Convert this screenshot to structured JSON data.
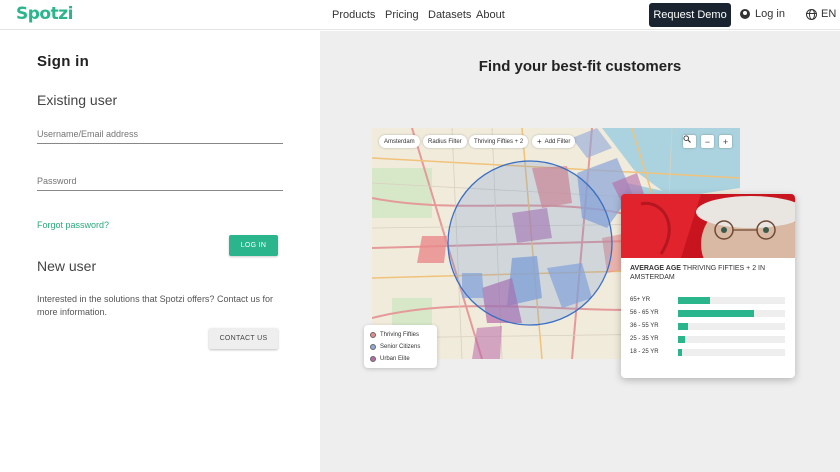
{
  "nav": {
    "logo": "Spotzi",
    "links": [
      "Products",
      "Pricing",
      "Datasets",
      "About"
    ],
    "request_demo": "Request Demo",
    "login": "Log in",
    "lang": "EN"
  },
  "signin": {
    "title": "Sign in",
    "existing_heading": "Existing user",
    "username_placeholder": "Username/Email address",
    "password_placeholder": "Password",
    "forgot": "Forgot password?",
    "login_button": "LOG IN",
    "new_heading": "New user",
    "new_desc": "Interested in the solutions that Spotzi offers? Contact us for more information.",
    "contact_button": "CONTACT US"
  },
  "promo": {
    "heading": "Find your best-fit customers",
    "chips": [
      "Amsterdam",
      "Radius Filter",
      "Thriving Fifties + 2",
      "Add Filter"
    ],
    "map_buttons": [
      "search-icon",
      "zoom-out-icon",
      "zoom-in-icon"
    ],
    "legend": [
      {
        "label": "Thriving Fifties",
        "color": "#e88a8a"
      },
      {
        "label": "Senior Citizens",
        "color": "#8fa8d8"
      },
      {
        "label": "Urban Elite",
        "color": "#b86aa8"
      }
    ],
    "card": {
      "title_bold": "AVERAGE AGE",
      "title_rest": "THRIVING FIFTIES + 2 IN AMSTERDAM",
      "bars": [
        {
          "label": "65+ YR",
          "value": 0.3
        },
        {
          "label": "56 - 65 YR",
          "value": 0.71
        },
        {
          "label": "36 - 55 YR",
          "value": 0.09
        },
        {
          "label": "25 - 35 YR",
          "value": 0.07
        },
        {
          "label": "18 - 25 YR",
          "value": 0.04
        }
      ]
    }
  }
}
